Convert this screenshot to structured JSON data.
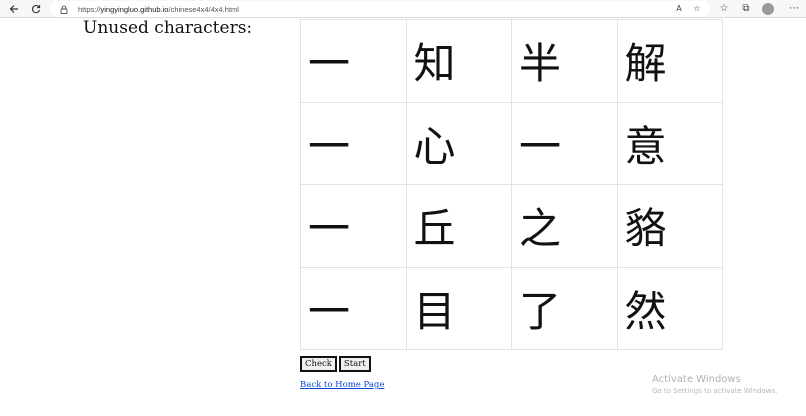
{
  "browser": {
    "url_scheme": "https://",
    "url_host": "yingyingluo.github.io",
    "url_path": "/chinese4x4/4x4.html",
    "icons": [
      "back-icon",
      "refresh-icon",
      "lock-icon",
      "read-aloud-icon",
      "favorite-add-icon",
      "favorites-icon",
      "collections-icon",
      "profile-icon"
    ]
  },
  "page": {
    "heading": "Unused characters:",
    "grid": [
      [
        "一",
        "知",
        "半",
        "解"
      ],
      [
        "一",
        "心",
        "一",
        "意"
      ],
      [
        "一",
        "丘",
        "之",
        "貉"
      ],
      [
        "一",
        "目",
        "了",
        "然"
      ]
    ],
    "check_label": "Check",
    "start_label": "Start",
    "home_link": "Back to Home Page"
  },
  "watermark": {
    "title": "Activate Windows",
    "subtitle": "Go to Settings to activate Windows."
  }
}
